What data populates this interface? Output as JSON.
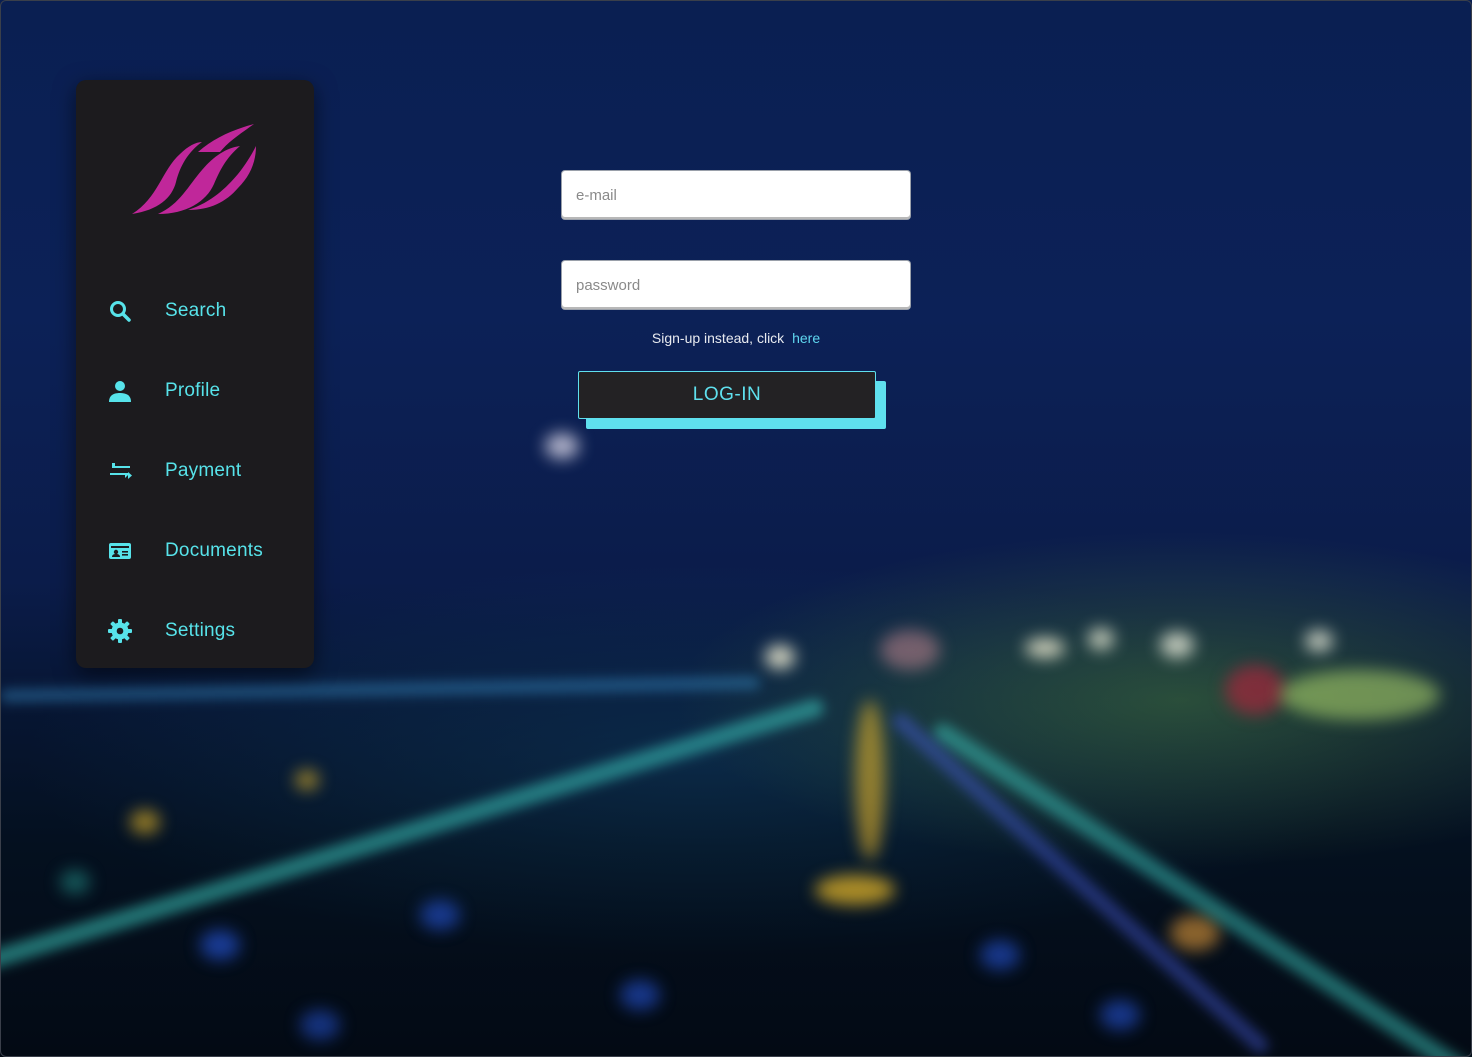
{
  "brand": {
    "logo_icon": "flame-wings-logo",
    "logo_color": "#c0279a"
  },
  "accent_color": "#57e3ea",
  "sidebar": {
    "items": [
      {
        "label": "Search",
        "icon": "search-icon"
      },
      {
        "label": "Profile",
        "icon": "person-icon"
      },
      {
        "label": "Payment",
        "icon": "swap-arrows-icon"
      },
      {
        "label": "Documents",
        "icon": "id-card-icon"
      },
      {
        "label": "Settings",
        "icon": "gear-icon"
      }
    ]
  },
  "login_form": {
    "email_placeholder": "e-mail",
    "email_value": "",
    "password_placeholder": "password",
    "password_value": "",
    "signup_text": "Sign-up instead, click",
    "signup_link": "here",
    "submit_label": "LOG-IN"
  }
}
